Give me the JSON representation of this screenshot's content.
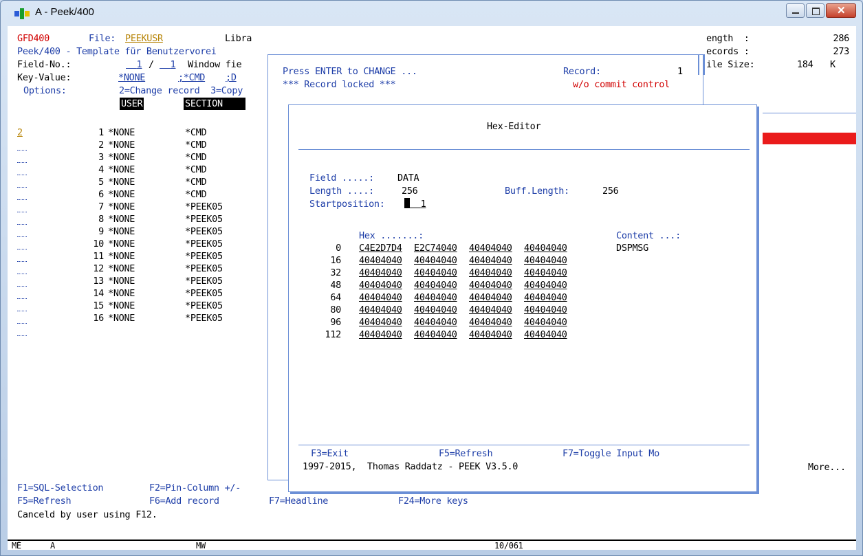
{
  "window": {
    "title": "A - Peek/400"
  },
  "header": {
    "program": "GFD400",
    "file_label": "File:",
    "file_value": "PEEKUSR",
    "lib_label": "Libra",
    "subtitle": "Peek/400 - Template für Benutzervorei",
    "field_no_label": "Field-No.:",
    "field_no_value": "1",
    "field_no_sep": "/",
    "field_no_value2": "1",
    "window_field": "Window fie",
    "key_value_label": "Key-Value:",
    "key1": "*NONE",
    "key2": ";*CMD",
    "key3": ";D",
    "options_label": "Options:",
    "options_text": "2=Change record  3=Copy",
    "col1": "USER",
    "col2": "SECTION"
  },
  "right_info": {
    "length_label": "ength  :",
    "length_value": "286",
    "records_label": "ecords :",
    "records_value": "273",
    "filesize_label": "ile Size:",
    "filesize_value": "184",
    "filesize_unit": "K"
  },
  "list": {
    "selected_option": "2",
    "rows": [
      {
        "num": "1",
        "user": "*NONE",
        "section": "*CMD"
      },
      {
        "num": "2",
        "user": "*NONE",
        "section": "*CMD"
      },
      {
        "num": "3",
        "user": "*NONE",
        "section": "*CMD"
      },
      {
        "num": "4",
        "user": "*NONE",
        "section": "*CMD"
      },
      {
        "num": "5",
        "user": "*NONE",
        "section": "*CMD"
      },
      {
        "num": "6",
        "user": "*NONE",
        "section": "*CMD"
      },
      {
        "num": "7",
        "user": "*NONE",
        "section": "*PEEK05"
      },
      {
        "num": "8",
        "user": "*NONE",
        "section": "*PEEK05"
      },
      {
        "num": "9",
        "user": "*NONE",
        "section": "*PEEK05"
      },
      {
        "num": "10",
        "user": "*NONE",
        "section": "*PEEK05"
      },
      {
        "num": "11",
        "user": "*NONE",
        "section": "*PEEK05"
      },
      {
        "num": "12",
        "user": "*NONE",
        "section": "*PEEK05"
      },
      {
        "num": "13",
        "user": "*NONE",
        "section": "*PEEK05"
      },
      {
        "num": "14",
        "user": "*NONE",
        "section": "*PEEK05"
      },
      {
        "num": "15",
        "user": "*NONE",
        "section": "*PEEK05"
      },
      {
        "num": "16",
        "user": "*NONE",
        "section": "*PEEK05"
      }
    ]
  },
  "record_panel": {
    "prompt": "Press ENTER to CHANGE ...",
    "record_label": "Record:",
    "record_value": "1",
    "locked": "*** Record locked ***",
    "commit": "w/o commit control"
  },
  "hex_editor": {
    "title": "Hex-Editor",
    "field_label": "Field .....:",
    "field_value": "DATA",
    "length_label": "Length ....:",
    "length_value": "256",
    "buff_label": "Buff.Length:",
    "buff_value": "256",
    "startpos_label": "Startposition:",
    "startpos_value": "1",
    "hex_header": "Hex .......:",
    "content_header": "Content ...:",
    "rows": [
      {
        "offset": "0",
        "w1": "C4E2D7D4",
        "w2": "E2C74040",
        "w3": "40404040",
        "w4": "40404040",
        "content": "DSPMSG"
      },
      {
        "offset": "16",
        "w1": "40404040",
        "w2": "40404040",
        "w3": "40404040",
        "w4": "40404040",
        "content": ""
      },
      {
        "offset": "32",
        "w1": "40404040",
        "w2": "40404040",
        "w3": "40404040",
        "w4": "40404040",
        "content": ""
      },
      {
        "offset": "48",
        "w1": "40404040",
        "w2": "40404040",
        "w3": "40404040",
        "w4": "40404040",
        "content": ""
      },
      {
        "offset": "64",
        "w1": "40404040",
        "w2": "40404040",
        "w3": "40404040",
        "w4": "40404040",
        "content": ""
      },
      {
        "offset": "80",
        "w1": "40404040",
        "w2": "40404040",
        "w3": "40404040",
        "w4": "40404040",
        "content": ""
      },
      {
        "offset": "96",
        "w1": "40404040",
        "w2": "40404040",
        "w3": "40404040",
        "w4": "40404040",
        "content": ""
      },
      {
        "offset": "112",
        "w1": "40404040",
        "w2": "40404040",
        "w3": "40404040",
        "w4": "40404040",
        "content": ""
      }
    ],
    "f3": "F3=Exit",
    "f5": "F5=Refresh",
    "f7": "F7=Toggle Input Mo",
    "copyright": "1997-2015,  Thomas Raddatz - PEEK V3.5.0"
  },
  "footer": {
    "more": "More...",
    "f1": "F1=SQL-Selection",
    "f2": "F2=Pin-Column +/-",
    "f5": "F5=Refresh",
    "f6": "F6=Add record",
    "f7": "F7=Headline",
    "f24": "F24=More keys",
    "message": "Canceld by user using F12."
  },
  "status": {
    "left": "MÉ",
    "mode": "A",
    "mw": "MW",
    "pos": "10/061"
  }
}
